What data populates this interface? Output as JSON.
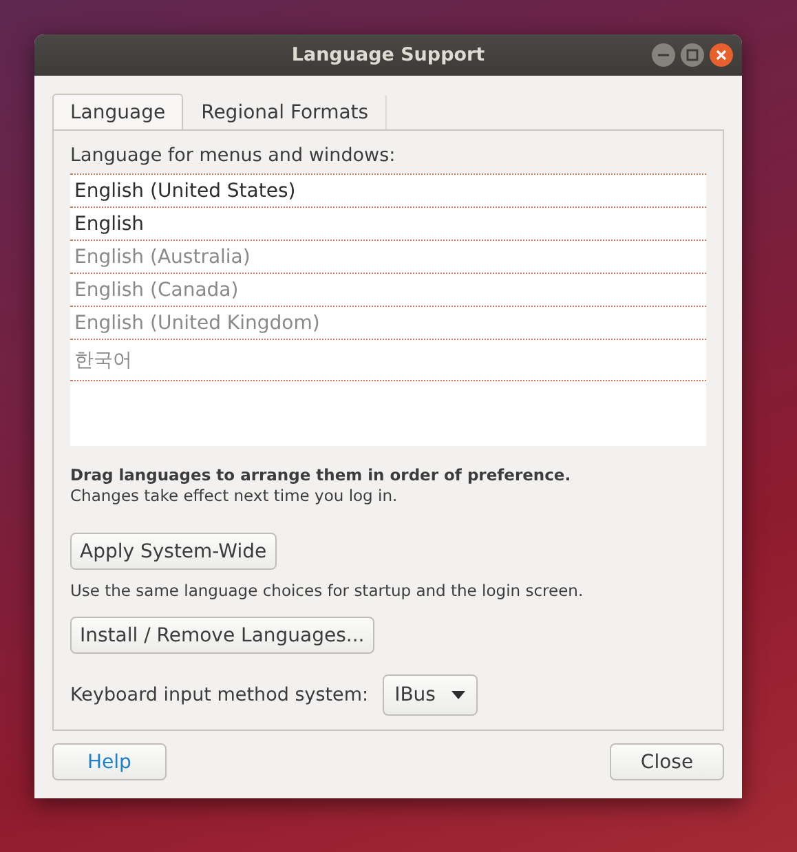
{
  "window": {
    "title": "Language Support"
  },
  "tabs": [
    {
      "label": "Language",
      "selected": true
    },
    {
      "label": "Regional Formats",
      "selected": false
    }
  ],
  "language_list": {
    "label": "Language for menus and windows:",
    "items": [
      {
        "name": "English (United States)",
        "disabled": false
      },
      {
        "name": "English",
        "disabled": false
      },
      {
        "name": "English (Australia)",
        "disabled": true
      },
      {
        "name": "English (Canada)",
        "disabled": true
      },
      {
        "name": "English (United Kingdom)",
        "disabled": true
      },
      {
        "name": "한국어",
        "disabled": true
      }
    ]
  },
  "drag_hint": "Drag languages to arrange them in order of preference.",
  "changes_note": "Changes take effect next time you log in.",
  "apply_button": "Apply System-Wide",
  "apply_note": "Use the same language choices for startup and the login screen.",
  "install_button": "Install / Remove Languages...",
  "input_method": {
    "label": "Keyboard input method system:",
    "value": "IBus"
  },
  "buttons": {
    "help": "Help",
    "close": "Close"
  }
}
